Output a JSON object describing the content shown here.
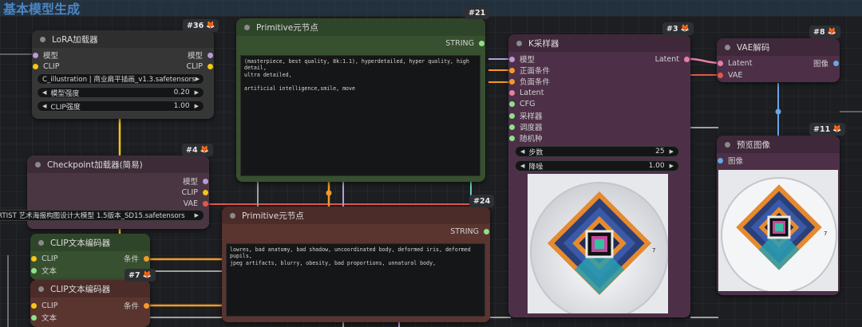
{
  "group": {
    "title": "基本模型生成"
  },
  "colors": {
    "accent": "#4a86c4",
    "canvas": "#1c1e21"
  },
  "nodes": {
    "lora": {
      "title": "LoRA加载器",
      "id": "#36",
      "inputs": [
        "模型",
        "CLIP"
      ],
      "outputs": [
        "模型",
        "CLIP"
      ],
      "lora_name": "C_illustration | 商业扁平插画_v1.3.safetensors",
      "model_strength_label": "模型强度",
      "model_strength": "0.20",
      "clip_strength_label": "CLIP强度",
      "clip_strength": "1.00"
    },
    "checkpoint": {
      "title": "Checkpoint加载器(简易)",
      "id": "#4",
      "outputs": [
        "模型",
        "CLIP",
        "VAE"
      ],
      "ckpt_name": "RTIST 艺术海报构图设计大模型 1.5版本_SD15.safetensors"
    },
    "prim_pos": {
      "title": "Primitive元节点",
      "id": "#21",
      "output": "STRING",
      "text": "(masterpiece, best quality, 8k:1.1), hyperdetailed, hyper quality, high detail,\nultra detailed,\n\nartificial intelligence,smile, move"
    },
    "prim_neg": {
      "title": "Primitive元节点",
      "id": "#24",
      "output": "STRING",
      "text": "lowres, bad anatomy, bad shadow, uncoordinated body, deformed iris, deformed pupils,\njpeg artifacts, blurry, obesity, bad proportions, unnatural body,"
    },
    "clip1": {
      "title": "CLIP文本编码器",
      "inputs": [
        "CLIP",
        "文本"
      ],
      "output": "条件"
    },
    "clip2": {
      "title": "CLIP文本编码器",
      "id": "#7",
      "inputs": [
        "CLIP",
        "文本"
      ],
      "output": "条件"
    },
    "ksampler": {
      "title": "K采样器",
      "id": "#3",
      "inputs": [
        "模型",
        "正面条件",
        "负面条件",
        "Latent",
        "CFG",
        "采样器",
        "调度器",
        "随机种"
      ],
      "output": "Latent",
      "steps_label": "步数",
      "steps": "25",
      "denoise_label": "降噪",
      "denoise": "1.00",
      "preview_number": "7"
    },
    "vae": {
      "title": "VAE解码",
      "id": "#8",
      "inputs": [
        "Latent",
        "VAE"
      ],
      "output": "图像"
    },
    "preview": {
      "title": "预览图像",
      "id": "#11",
      "input": "图像",
      "preview_number": "7"
    }
  }
}
